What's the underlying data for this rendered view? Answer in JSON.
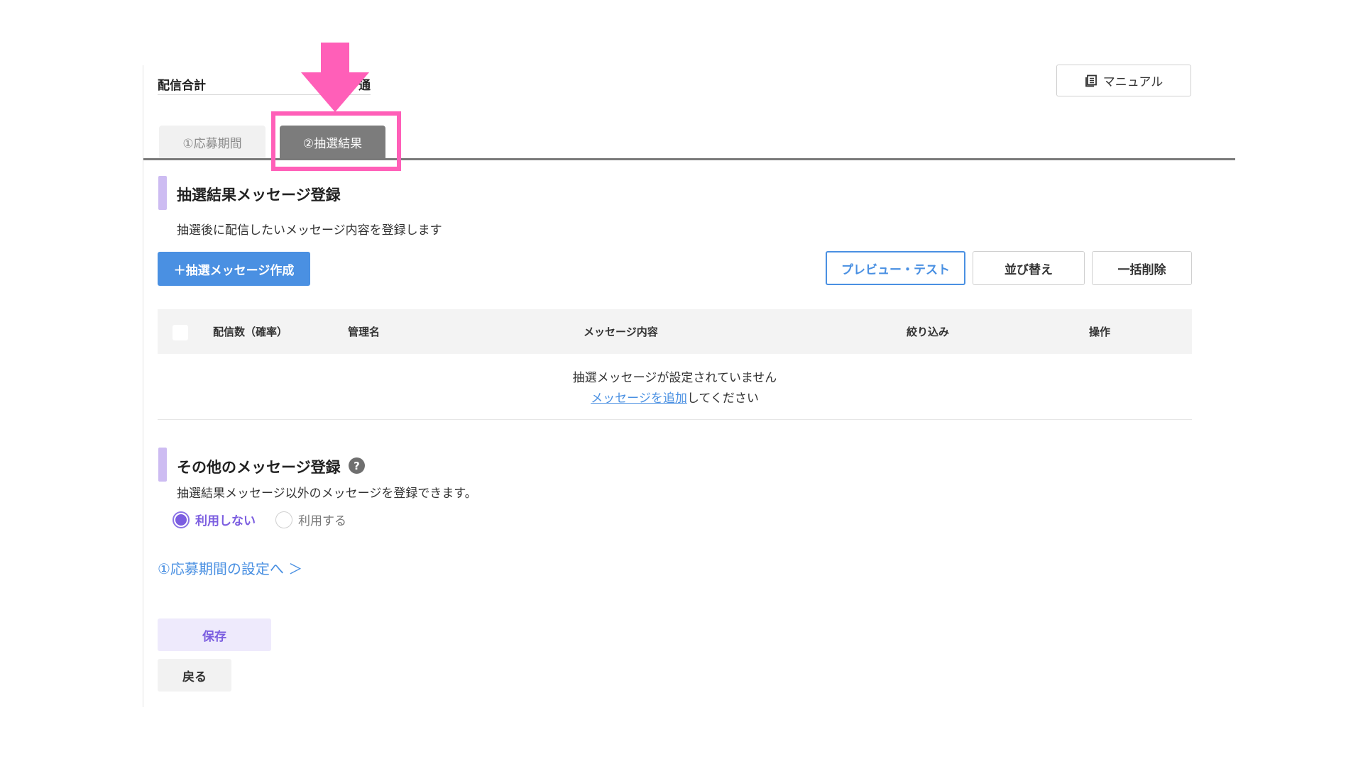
{
  "summary": {
    "label": "配信合計",
    "unit": "通"
  },
  "manual_button": {
    "label": "マニュアル",
    "icon": "book-icon"
  },
  "tabs": [
    {
      "label": "①応募期間",
      "active": false
    },
    {
      "label": "②抽選結果",
      "active": true
    }
  ],
  "annotation": {
    "color": "#ff5fb8",
    "icon": "down-arrow-icon"
  },
  "result_section": {
    "title": "抽選結果メッセージ登録",
    "description": "抽選後に配信したいメッセージ内容を登録します",
    "create_button": "＋抽選メッセージ作成",
    "preview_button": "プレビュー・テスト",
    "sort_button": "並び替え",
    "bulk_delete_button": "一括削除",
    "table": {
      "headers": [
        "配信数（確率）",
        "管理名",
        "メッセージ内容",
        "絞り込み",
        "操作"
      ],
      "empty_message": "抽選メッセージが設定されていません",
      "empty_link": "メッセージを追加",
      "empty_suffix": "してください"
    }
  },
  "other_section": {
    "title": "その他のメッセージ登録",
    "help_icon": "question-icon",
    "description": "抽選結果メッセージ以外のメッセージを登録できます。",
    "options": [
      {
        "label": "利用しない",
        "selected": true
      },
      {
        "label": "利用する",
        "selected": false
      }
    ]
  },
  "back_to_period_link": "①応募期間の設定へ ＞",
  "save_button": "保存",
  "back_button": "戻る",
  "colors": {
    "accent_blue": "#4a90e2",
    "accent_purple": "#7b5de0",
    "section_bar": "#cdbcf2",
    "highlight_pink": "#ff5fb8"
  }
}
